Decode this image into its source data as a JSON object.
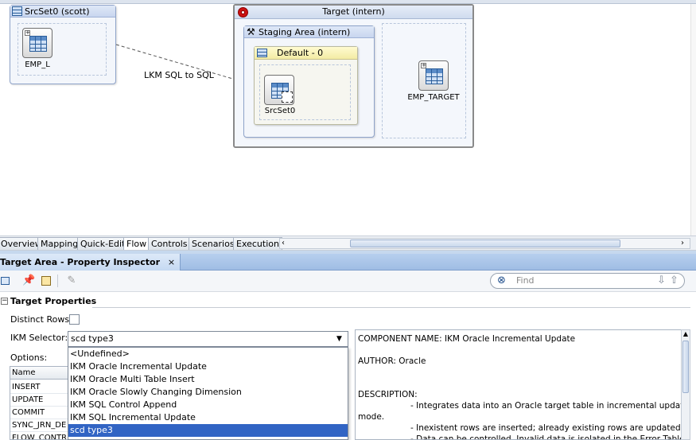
{
  "canvas": {
    "source_set": {
      "title": "SrcSet0 (scott)",
      "component": "EMP_L"
    },
    "target_box": {
      "title": "Target (intern)"
    },
    "staging_area": {
      "title": "Staging Area (intern)"
    },
    "default_box": {
      "title": "Default - 0",
      "component": "SrcSet0"
    },
    "target_component": "EMP_TARGET",
    "lkm_label": "LKM SQL to SQL"
  },
  "tabs": [
    {
      "label": "Overview"
    },
    {
      "label": "Mapping"
    },
    {
      "label": "Quick-Edit"
    },
    {
      "label": "Flow",
      "active": true
    },
    {
      "label": "Controls"
    },
    {
      "label": "Scenarios"
    },
    {
      "label": "Execution"
    }
  ],
  "inspector": {
    "title": "Target Area - Property Inspector",
    "close_glyph": "×",
    "find_placeholder": "Find",
    "section_title": "Target Properties",
    "distinct_rows_label": "Distinct Rows:",
    "ikm_selector_label": "IKM Selector:",
    "ikm_selected": "scd type3",
    "options_label": "Options:",
    "dropdown_options": [
      "<Undefined>",
      "IKM Oracle Incremental Update",
      "IKM Oracle Multi Table Insert",
      "IKM Oracle Slowly Changing Dimension",
      "IKM SQL Control Append",
      "IKM SQL Incremental Update",
      "scd type3"
    ],
    "options_table": {
      "header": "Name",
      "rows": [
        "INSERT",
        "UPDATE",
        "COMMIT",
        "SYNC_JRN_DE",
        "FLOW_CONTR"
      ]
    },
    "description": {
      "component_name": "COMPONENT NAME: IKM Oracle Incremental Update",
      "author": "AUTHOR: Oracle",
      "heading": "DESCRIPTION:",
      "line1": "- Integrates data into an Oracle target table in incremental update",
      "line2": "mode.",
      "line3": "- Inexistent rows are inserted; already existing rows are updated.",
      "line4": "- Data can be controlled. Invalid data is isolated in the Error Table"
    }
  },
  "colors": {
    "accent": "#3164c4",
    "panel_header": "#9fbde4",
    "target_border": "#8a8a8a",
    "stop_icon": "#cc1111"
  }
}
